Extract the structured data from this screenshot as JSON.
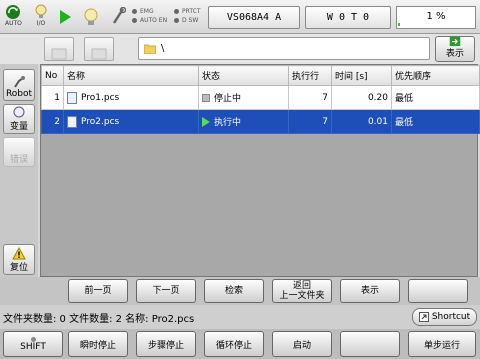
{
  "status_bar": {
    "auto_label": "AUTO",
    "io_label": "I/O",
    "indicators": [
      "EMG",
      "PRTCT",
      "AUTO EN",
      "D SW"
    ],
    "robot_model": "VS068A4 A",
    "tool_work": "W 0 T 0",
    "speed_percent": "1 %",
    "speed_fraction": 0.01,
    "colors": {
      "play": "#22b022",
      "progress": "#38c038"
    }
  },
  "toolbar": {
    "path": "\\",
    "show_label": "表示"
  },
  "sidebar": {
    "robot_label": "Robot",
    "variable_label": "变量",
    "error_label": "错误",
    "reset_label": "复位"
  },
  "table": {
    "headers": [
      "No",
      "名称",
      "状态",
      "执行行",
      "时间 [s]",
      "优先顺序"
    ],
    "rows": [
      {
        "no": "1",
        "name": "Pro1.pcs",
        "status": "停止中",
        "line": "7",
        "time": "0.20",
        "priority": "最低",
        "selected": false
      },
      {
        "no": "2",
        "name": "Pro2.pcs",
        "status": "执行中",
        "line": "7",
        "time": "0.01",
        "priority": "最低",
        "selected": true
      }
    ],
    "colors": {
      "selected_row": "#1e4fb8"
    }
  },
  "fkeys": {
    "prev": "前一页",
    "next": "下一页",
    "search": "检索",
    "back_line1": "返回",
    "back_line2": "上一文件夹",
    "show": "表示"
  },
  "status_line": {
    "text": "文件夹数量: 0  文件数量: 2  名称: Pro2.pcs",
    "shortcut": "Shortcut"
  },
  "bottom_keys": {
    "shift": "SHIFT",
    "instant_stop": "瞬时停止",
    "step_stop": "步骤停止",
    "cycle_stop": "循环停止",
    "start": "启动",
    "step_run": "单步运行"
  }
}
